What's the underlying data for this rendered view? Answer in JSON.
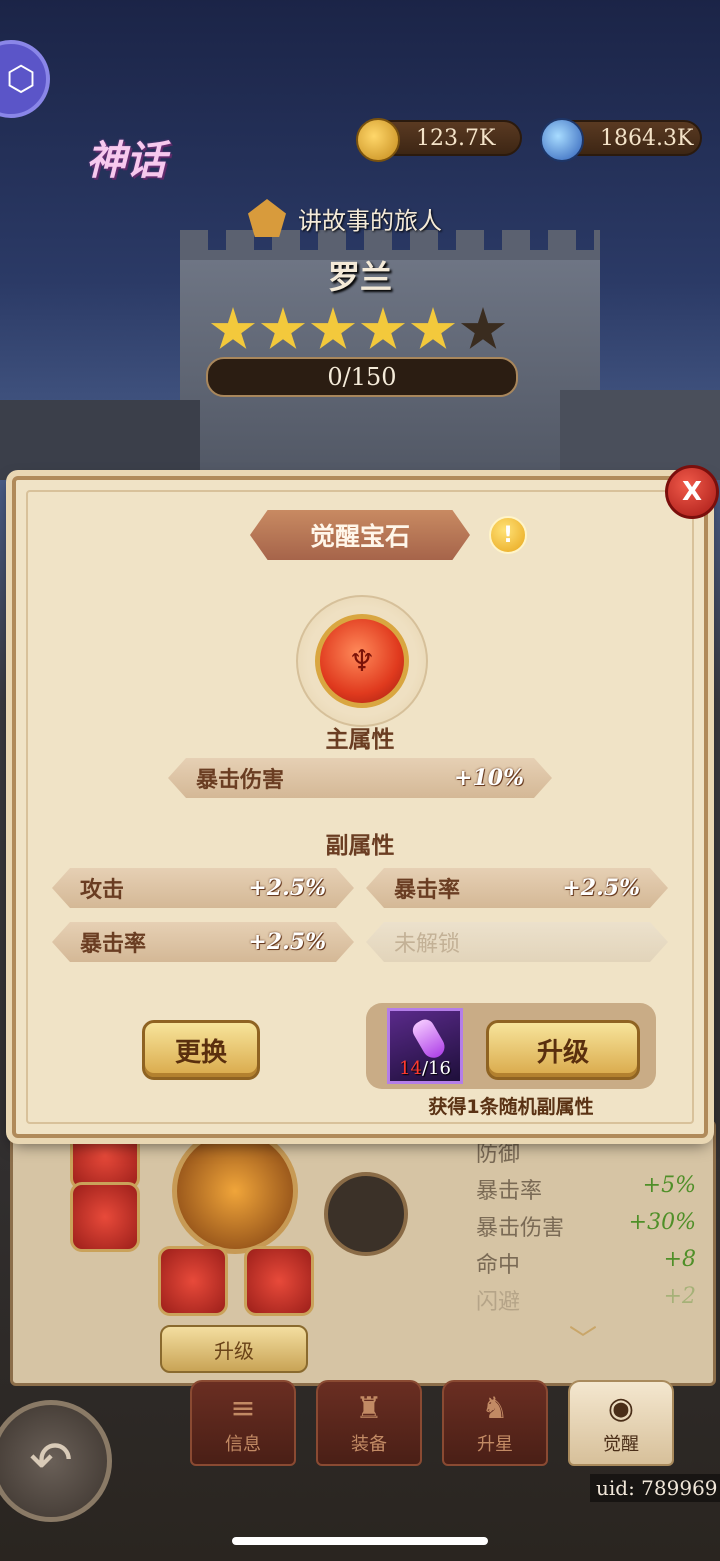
{
  "header": {
    "rarity": "神话",
    "gold": "123.7K",
    "crystal": "1864.3K",
    "hero_title": "讲故事的旅人",
    "hero_name": "罗兰",
    "stars_filled": 5,
    "stars_total": 6,
    "exp": "0/150"
  },
  "dialog": {
    "title": "觉醒宝石",
    "close_label": "X",
    "info_label": "!",
    "main_attr_label": "主属性",
    "main_attr": {
      "name": "暴击伤害",
      "value": "+10%"
    },
    "sub_attr_label": "副属性",
    "sub_attrs": [
      {
        "name": "攻击",
        "value": "+2.5%"
      },
      {
        "name": "暴击率",
        "value": "+2.5%"
      },
      {
        "name": "暴击率",
        "value": "+2.5%"
      },
      {
        "name": "未解锁",
        "value": ""
      }
    ],
    "replace_label": "更换",
    "upgrade_label": "升级",
    "item_count_current": "14",
    "item_count_total": "/16",
    "upgrade_note": "获得1条随机副属性"
  },
  "background_panel": {
    "upgrade_label": "升级",
    "stats": [
      {
        "name": "防御",
        "value": ""
      },
      {
        "name": "暴击率",
        "value": "+5%"
      },
      {
        "name": "暴击伤害",
        "value": "+30%"
      },
      {
        "name": "命中",
        "value": "+8"
      },
      {
        "name": "闪避",
        "value": "+2"
      }
    ]
  },
  "tabs": [
    {
      "label": "信息",
      "icon": "≡"
    },
    {
      "label": "装备",
      "icon": "♜"
    },
    {
      "label": "升星",
      "icon": "♞"
    },
    {
      "label": "觉醒",
      "icon": "◉"
    }
  ],
  "uid": "uid: 789969",
  "colors": {
    "accent_gold": "#d9a94a",
    "dialog_bg": "#f0e3c6",
    "title_bg": "#b87458",
    "close_red": "#c8241c"
  }
}
